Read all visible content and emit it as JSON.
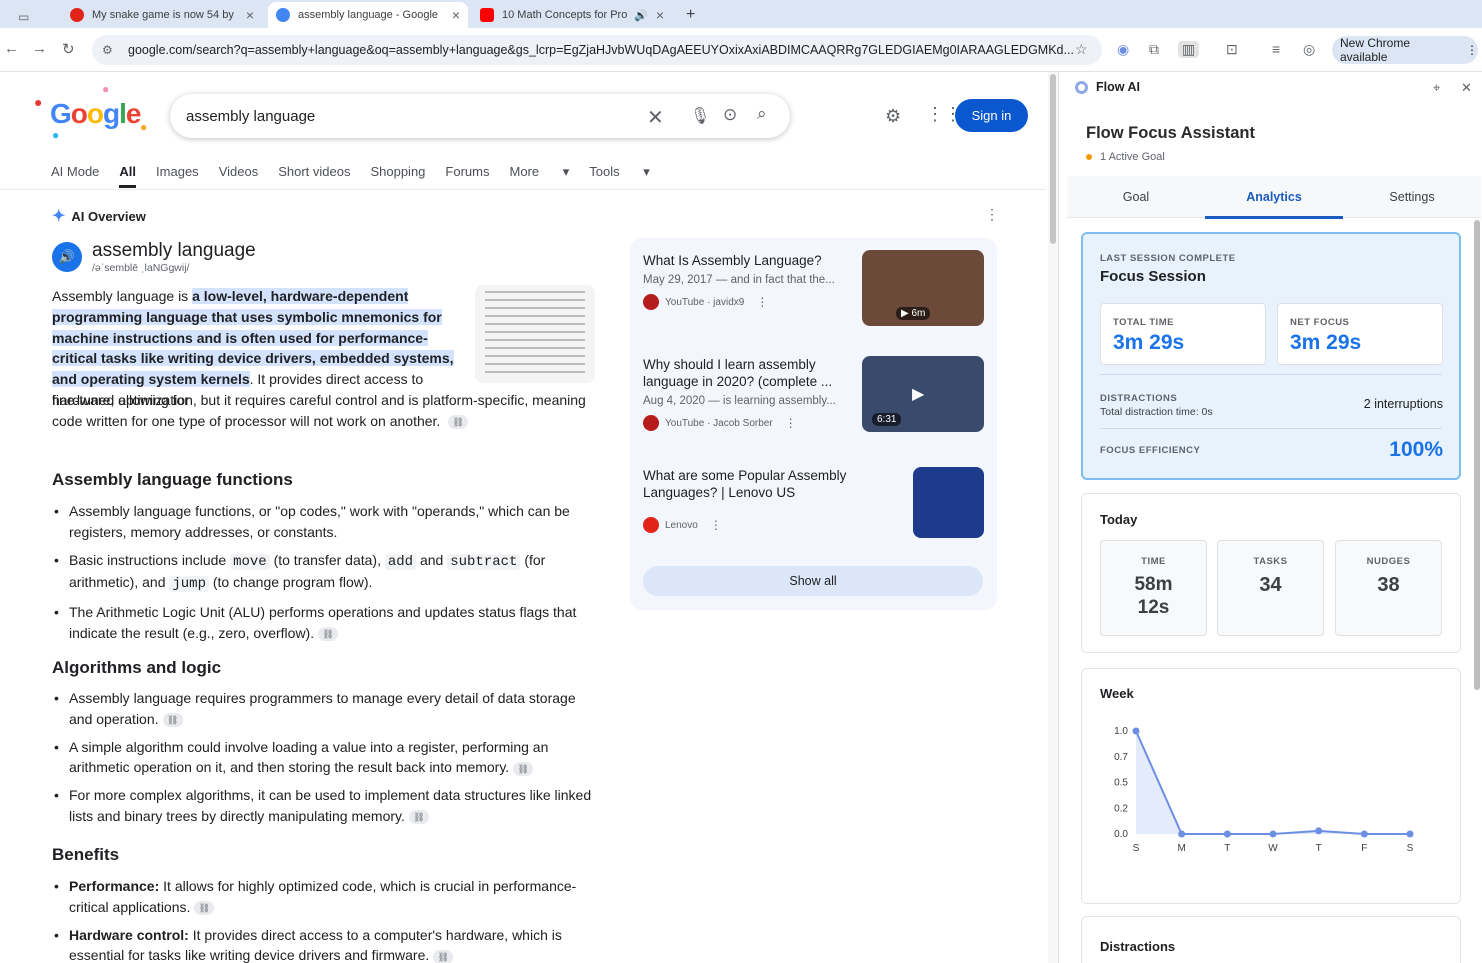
{
  "browser": {
    "tabs": [
      {
        "title": "My snake game is now 54 by",
        "favicon_color": "#e1251b"
      },
      {
        "title": "assembly language - Google",
        "favicon_color": "#4285f4"
      },
      {
        "title": "10 Math Concepts for Pro",
        "favicon_color": "#ff0000"
      }
    ],
    "url": "google.com/search?q=assembly+language&oq=assembly+language&gs_lcrp=EgZjaHJvbWUqDAgAEEUYOxixAxiABDIMCAAQRRg7GLEDGIAEMg0IARAAGLEDGMKd...",
    "update_label": "New Chrome available"
  },
  "google": {
    "logo": "Google",
    "query": "assembly language",
    "sign_in": "Sign in",
    "nav": [
      "AI Mode",
      "All",
      "Images",
      "Videos",
      "Short videos",
      "Shopping",
      "Forums",
      "More",
      "Tools"
    ]
  },
  "overview": {
    "heading": "AI Overview",
    "term": "assembly language",
    "ipa": "/əˈsemblē ˌlaNGgwij/",
    "intro_a": "Assembly language is ",
    "intro_hl": "a low-level, hardware-dependent programming language that uses symbolic mnemonics for machine instructions and is often used for performance-critical tasks like writing device drivers, embedded systems, and operating system kernels",
    "intro_b": ". It provides direct access to hardware, allowing for",
    "intro_c": "fine-tuned optimization, but it requires careful control and is platform-specific, meaning code written for one type of processor will not work on another.",
    "sec1": "Assembly language functions",
    "sec1_items": [
      "Assembly language functions, or \"op codes,\" work with \"operands,\" which can be registers, memory addresses, or constants."
    ],
    "basic_a": "Basic instructions include ",
    "code_move": "move",
    "basic_b": " (to transfer data), ",
    "code_add": "add",
    "basic_c": " and ",
    "code_sub": "subtract",
    "basic_d": " (for arithmetic), and ",
    "code_jump": "jump",
    "basic_e": " (to change program flow).",
    "alu": "The Arithmetic Logic Unit (ALU) performs operations and updates status flags that indicate the result (e.g., zero, overflow).",
    "sec2": "Algorithms and logic",
    "sec2_items": [
      "Assembly language requires programmers to manage every detail of data storage and operation.",
      "A simple algorithm could involve loading a value into a register, performing an arithmetic operation on it, and then storing the result back into memory.",
      "For more complex algorithms, it can be used to implement data structures like linked lists and binary trees by directly manipulating memory."
    ],
    "sec3": "Benefits",
    "perf_label": "Performance:",
    "perf_text": " It allows for highly optimized code, which is crucial in performance-critical applications.",
    "hw_label": "Hardware control:",
    "hw_text": " It provides direct access to a computer's hardware, which is essential for tasks like writing device drivers and firmware."
  },
  "videos": [
    {
      "title": "What Is Assembly Language?",
      "meta": "May 29, 2017 — and in fact that the...",
      "source": "YouTube · javidx9",
      "duration": "6m",
      "thumb_color": "#6b4a3a"
    },
    {
      "title": "Why should I learn assembly language in 2020? (complete ...",
      "meta": "Aug 4, 2020 — is learning assembly...",
      "source": "YouTube · Jacob Sorber",
      "duration": "6:31",
      "thumb_color": "#3a4a6b"
    },
    {
      "title": "What are some Popular Assembly Languages? | Lenovo US",
      "meta": "",
      "source": "Lenovo",
      "duration": "",
      "thumb_color": "#1e3a8a"
    }
  ],
  "show_all": "Show all",
  "panel": {
    "name": "Flow AI",
    "title": "Flow Focus Assistant",
    "goal_status": "1 Active Goal",
    "tabs": [
      "Goal",
      "Analytics",
      "Settings"
    ],
    "session_label": "LAST SESSION COMPLETE",
    "session_name": "Focus Session",
    "total_time_label": "TOTAL TIME",
    "total_time": "3m 29s",
    "net_focus_label": "NET FOCUS",
    "net_focus": "3m 29s",
    "distractions_label": "DISTRACTIONS",
    "distraction_time": "Total distraction time: 0s",
    "interruptions": "2 interruptions",
    "efficiency_label": "FOCUS EFFICIENCY",
    "efficiency": "100%",
    "today_label": "Today",
    "today_time_label": "TIME",
    "today_time_a": "58m",
    "today_time_b": "12s",
    "tasks_label": "TASKS",
    "tasks": "34",
    "nudges_label": "NUDGES",
    "nudges": "38",
    "week_label": "Week",
    "distractions_heading": "Distractions"
  },
  "chart_data": {
    "type": "area",
    "categories": [
      "S",
      "M",
      "T",
      "W",
      "T",
      "F",
      "S"
    ],
    "values": [
      1.0,
      0.0,
      0.0,
      0.0,
      0.03,
      0.0,
      0.0
    ],
    "yticks": [
      "1.0",
      "0.7",
      "0.5",
      "0.2",
      "0.0"
    ],
    "ylim": [
      0,
      1
    ],
    "color": "#6c8ee3"
  }
}
